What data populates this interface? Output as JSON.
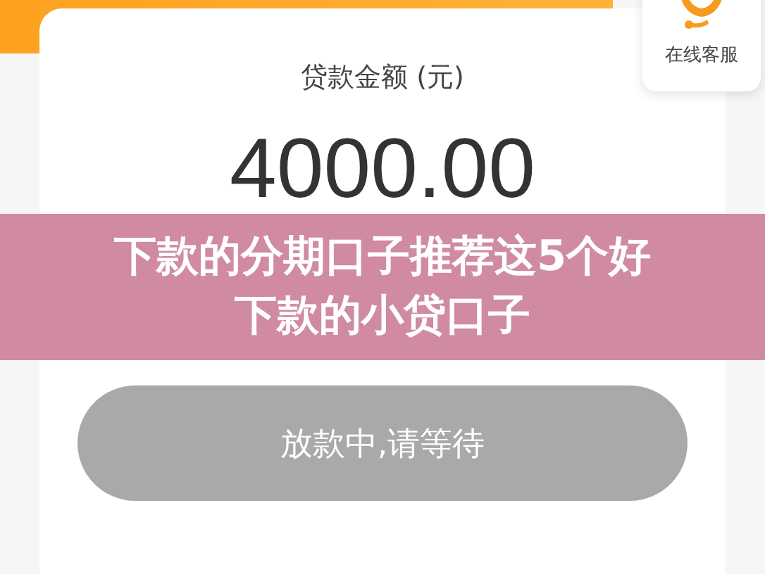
{
  "service_widget": {
    "label": "在线客服"
  },
  "loan_card": {
    "amount_label": "贷款金额 (元)",
    "amount": "4000.00",
    "status_button": {
      "label": "放款中,请等待",
      "disabled": true
    }
  },
  "caption_banner": {
    "lines": [
      "下款的分期口子推荐这5个好",
      "下款的小贷口子"
    ]
  }
}
